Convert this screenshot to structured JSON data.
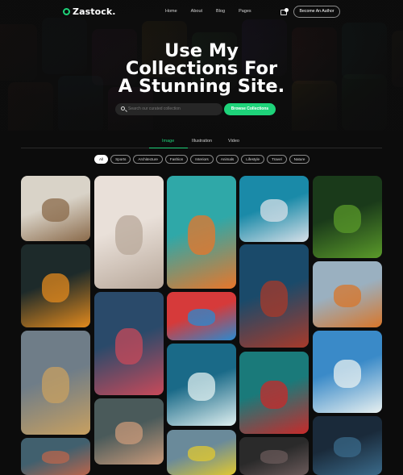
{
  "brand": {
    "name": "Zastock.",
    "logo_icon": "leaf-drop-icon",
    "accent": "#1ed37a"
  },
  "nav": {
    "links": [
      "Home",
      "About",
      "Blog",
      "Pages"
    ],
    "cart_icon": "cart-icon",
    "cart_count": "",
    "cta": "Become An Author"
  },
  "hero": {
    "title_lines": [
      "Use My",
      "Collections For",
      "A Stunning Site."
    ],
    "search_placeholder": "Search our curated collection",
    "browse_label": "Browse Collections"
  },
  "tabs": {
    "items": [
      "Image",
      "Illustration",
      "Video"
    ],
    "active": "Image"
  },
  "filters": {
    "items": [
      "All",
      "Sports",
      "Architecture",
      "Fashion",
      "Interiors",
      "Animals",
      "Lifestyle",
      "Travel",
      "Nature"
    ],
    "active": "All"
  },
  "gallery": [
    {
      "subject": "modern living room interior",
      "colors": [
        "#d9d3c8",
        "#8a6a4a"
      ]
    },
    {
      "subject": "orange parrot on branch",
      "colors": [
        "#1d2a2a",
        "#e38a1d"
      ]
    },
    {
      "subject": "glass skyscrapers looking up",
      "colors": [
        "#6f7d88",
        "#c8a060"
      ]
    },
    {
      "subject": "hot air balloons",
      "colors": [
        "#41606e",
        "#b9654c"
      ]
    },
    {
      "subject": "minimal beige room with plant",
      "colors": [
        "#e9e0d9",
        "#b8a89a"
      ]
    },
    {
      "subject": "colorful basketball court building",
      "colors": [
        "#2a4a6a",
        "#c84a5a"
      ]
    },
    {
      "subject": "man with camera hands",
      "colors": [
        "#4a5a5a",
        "#c99a7a"
      ]
    },
    {
      "subject": "illustrated city tram",
      "colors": [
        "#2fa8a8",
        "#e8762a"
      ]
    },
    {
      "subject": "abstract colorful paint",
      "colors": [
        "#d63a3a",
        "#2a8ad0"
      ]
    },
    {
      "subject": "ocean waves aerial",
      "colors": [
        "#1a6a88",
        "#e0f0f0"
      ]
    },
    {
      "subject": "yellow flowers",
      "colors": [
        "#6a8a9a",
        "#e0c830"
      ]
    },
    {
      "subject": "curved blue architecture",
      "colors": [
        "#1a8aa8",
        "#d8e0e8"
      ]
    },
    {
      "subject": "blue red coral texture",
      "colors": [
        "#1a4a6a",
        "#a83a2a"
      ]
    },
    {
      "subject": "woman with sunglasses on teal",
      "colors": [
        "#1a7a7a",
        "#c82a2a"
      ]
    },
    {
      "subject": "dark portrait",
      "colors": [
        "#2a2a2a",
        "#6a5a5a"
      ]
    },
    {
      "subject": "green leaves bokeh",
      "colors": [
        "#1a3a1a",
        "#5a9a2a"
      ]
    },
    {
      "subject": "red fox in snow",
      "colors": [
        "#9ab0c0",
        "#d8762a"
      ]
    },
    {
      "subject": "sailboat at sea",
      "colors": [
        "#3a8ac8",
        "#e8f0f0"
      ]
    },
    {
      "subject": "dark underwater",
      "colors": [
        "#1a2a3a",
        "#3a6a8a"
      ]
    }
  ]
}
